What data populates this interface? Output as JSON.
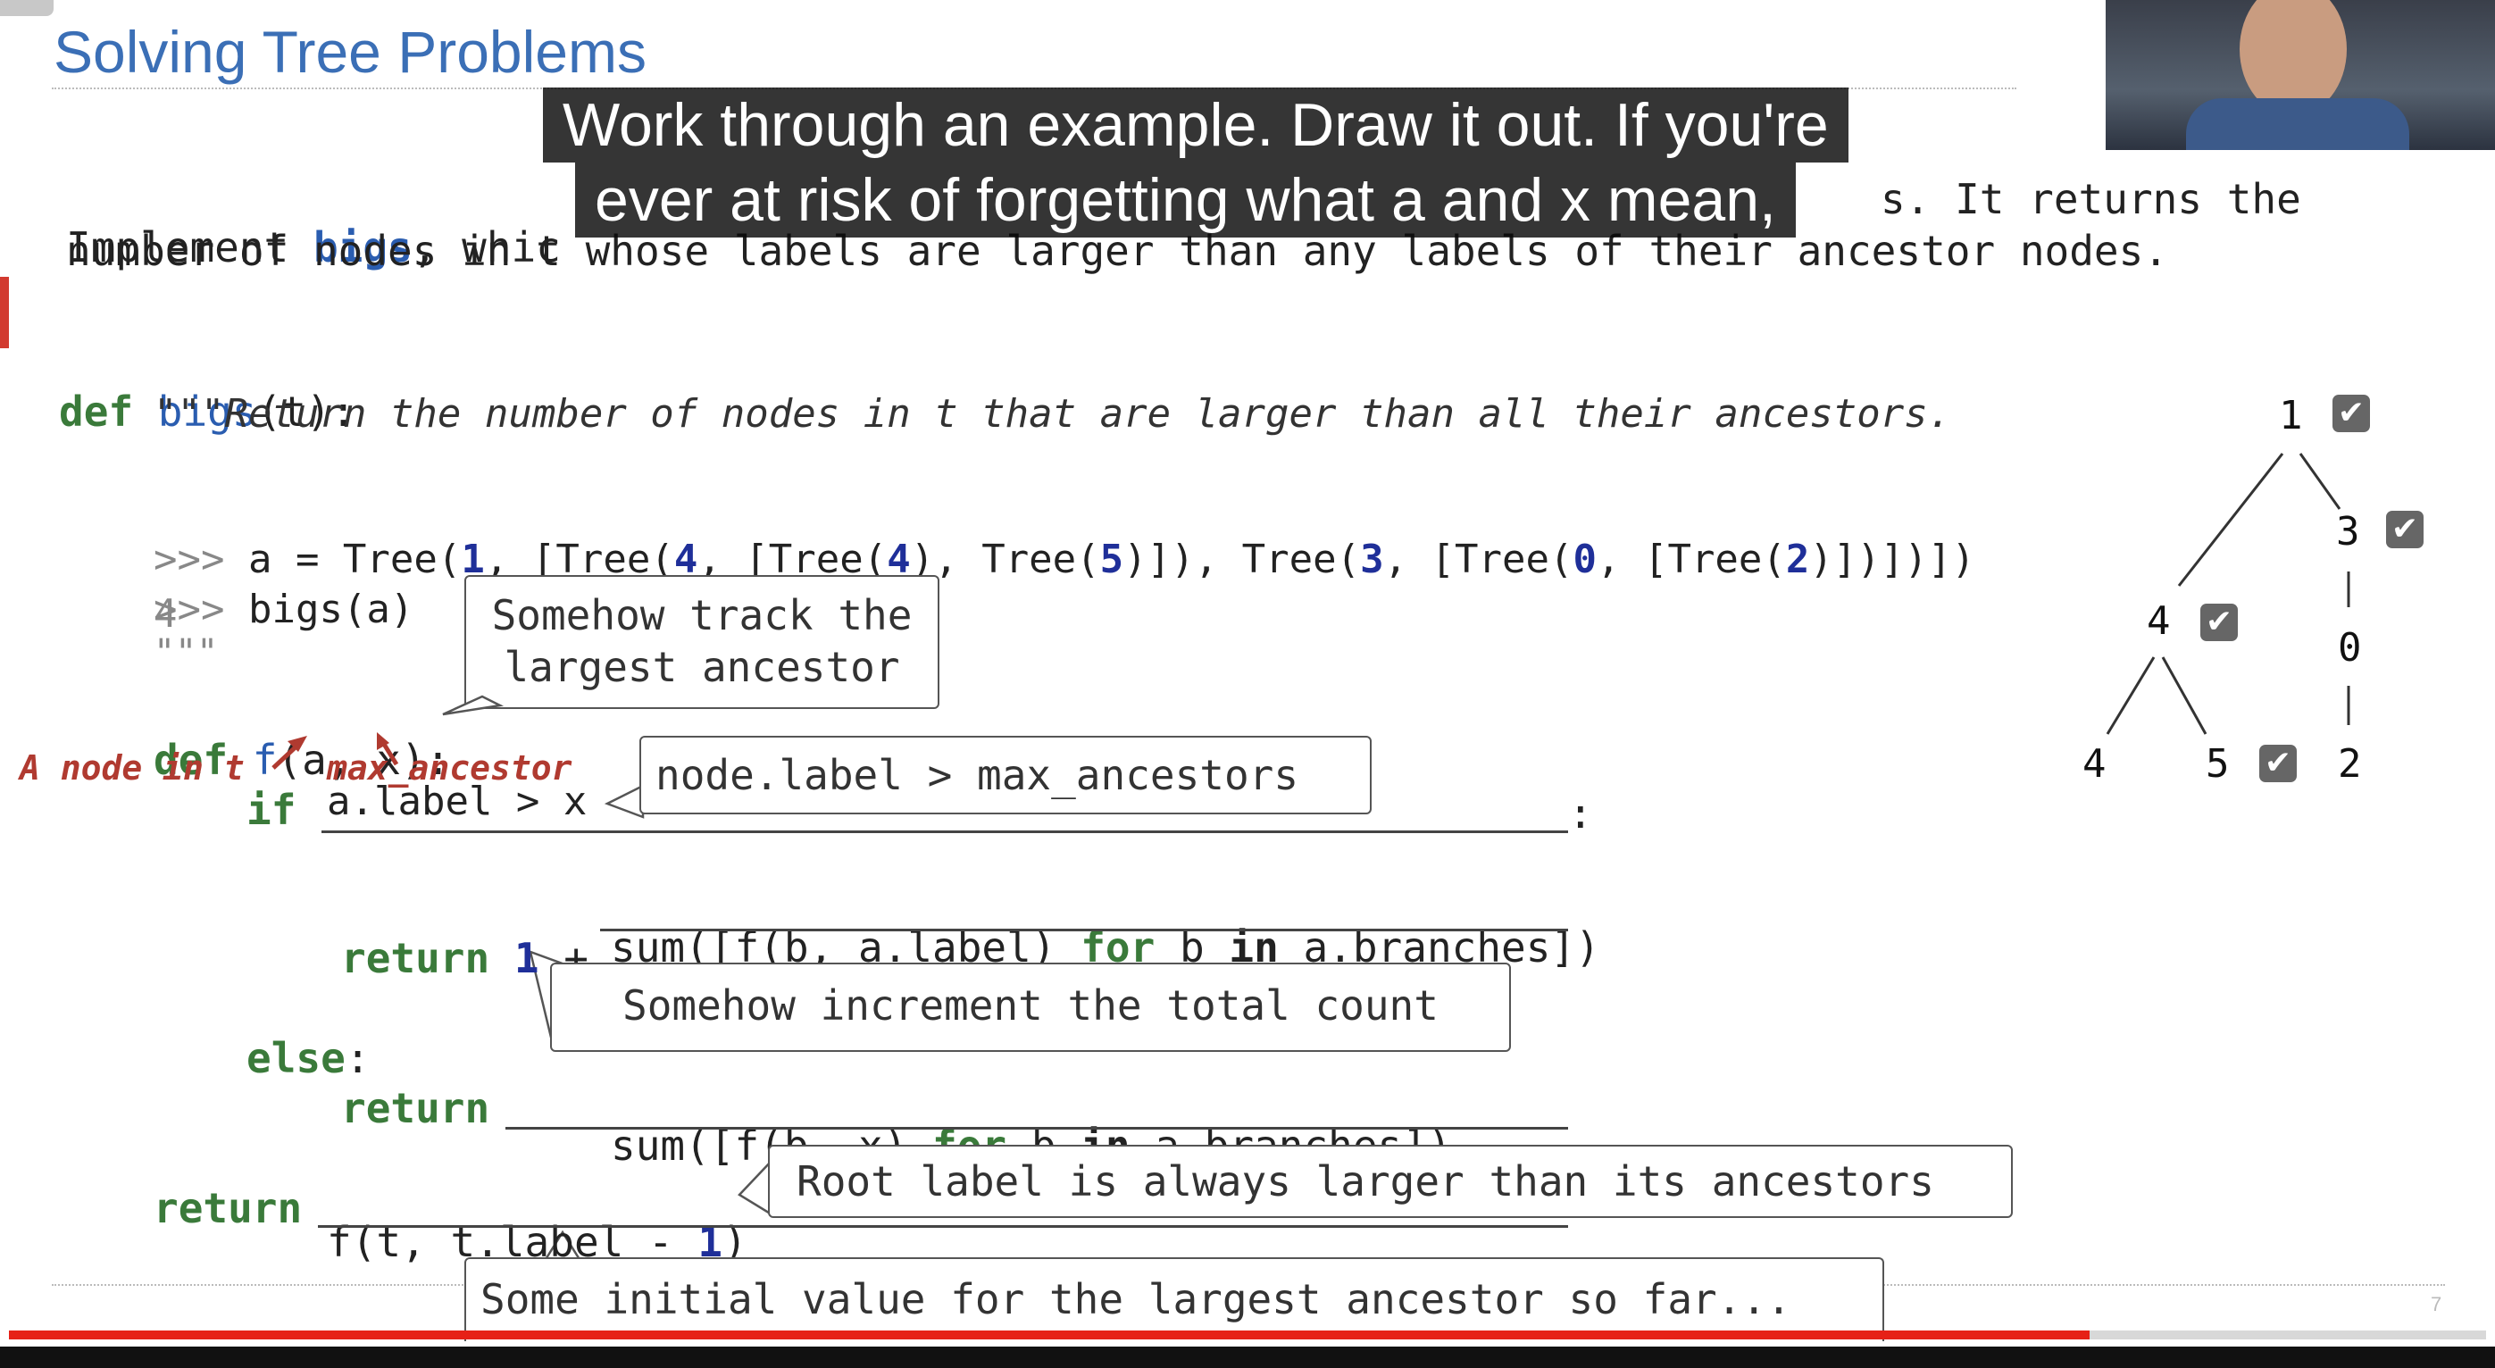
{
  "slide": {
    "title": "Solving Tree Problems",
    "intro_line1_a": "Implement ",
    "intro_line1_b": "bigs",
    "intro_line1_c": ", whic",
    "intro_line1_d": "s. It returns the",
    "intro_line2": "number of nodes in t whose labels are larger than any labels of their ancestor nodes.",
    "code": {
      "def_kw": "def ",
      "def_name": "bigs",
      "def_rest": "(t):",
      "docstring": "\"\"\"Return the number of nodes in t that are larger than all their ancestors.",
      "ex1_prompt": ">>> ",
      "ex1_a": "a = Tree(",
      "ex1_n1": "1",
      "ex1_b": ", [Tree(",
      "ex1_n4": "4",
      "ex1_c": ", [Tree(",
      "ex1_n4b": "4",
      "ex1_d": "), Tree(",
      "ex1_n5": "5",
      "ex1_e": ")]), Tree(",
      "ex1_n3": "3",
      "ex1_f": ", [Tree(",
      "ex1_n0": "0",
      "ex1_g": ", [Tree(",
      "ex1_n2": "2",
      "ex1_h": ")])])])",
      "ex2_prompt": ">>> ",
      "ex2_text": "bigs(a)",
      "ex_result": "4",
      "doc_end": "\"\"\"",
      "inner_def_kw": "def ",
      "inner_def_name": "f",
      "inner_def_rest": "(a, x):",
      "if_kw": "if",
      "if_blank": "a.label > x",
      "if_colon": ":",
      "return_kw": "return",
      "return1_num": "1",
      "return1_plus": " +",
      "return1_blank_a": "sum([f(b, a.label) ",
      "return1_blank_for": "for",
      "return1_blank_b": " b ",
      "return1_blank_in": "in",
      "return1_blank_c": " a.branches])",
      "else_kw": "else",
      "else_colon": ":",
      "return2_kw": "return",
      "return2_blank_a": "sum([f(b, x) ",
      "return2_blank_for": "for",
      "return2_blank_b": " b ",
      "return2_blank_in": "in",
      "return2_blank_c": " a.branches])",
      "final_return_kw": "return",
      "final_blank_a": "f(t, t.label - ",
      "final_blank_num": "1",
      "final_blank_b": ")"
    },
    "annotations": {
      "node_in_t": "A node in t",
      "max_ancestor": "max_ancestor",
      "track_largest_1": "Somehow track the",
      "track_largest_2": "largest ancestor",
      "node_label_gt": "node.label > max_ancestors",
      "increment_count": "Somehow increment the total count",
      "root_label": "Root label is always larger than its ancestors",
      "initial_value": "Some initial value for the largest ancestor so far..."
    },
    "tree": {
      "root": "1",
      "n3": "3",
      "n4": "4",
      "n0": "0",
      "n4leaf": "4",
      "n5": "5",
      "n2": "2"
    },
    "slide_number": "7"
  },
  "caption": {
    "line1": "Work through an example. Draw it out. If you're",
    "line2": "ever at risk of forgetting what a and x mean,"
  },
  "player": {
    "progress_fraction": 0.84,
    "progress_color": "#e62117"
  },
  "colors": {
    "title": "#3b6fb6",
    "keyword_green": "#3a7a3a",
    "name_blue": "#2a5db0",
    "number_navy": "#1f2f99",
    "annotation_red": "#b03a30"
  }
}
